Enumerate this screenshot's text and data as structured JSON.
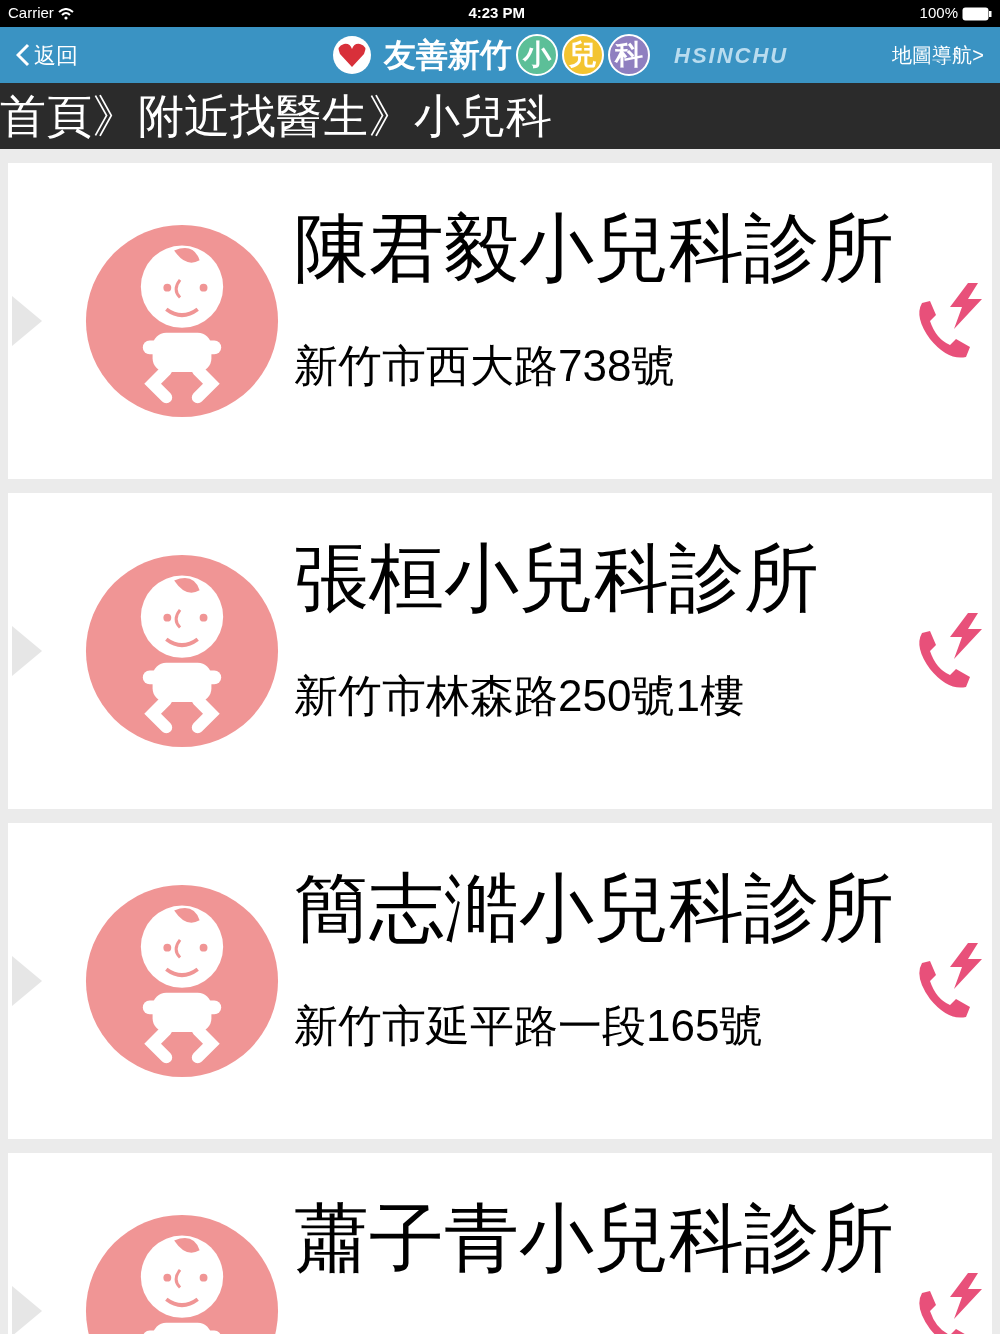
{
  "status_bar": {
    "carrier": "Carrier",
    "time": "4:23 PM",
    "battery": "100%"
  },
  "nav_bar": {
    "back": "返回",
    "title": "友善新竹",
    "title_badges": [
      {
        "text": "小",
        "color": "#5cbf98"
      },
      {
        "text": "兒",
        "color": "#f3c431"
      },
      {
        "text": "科",
        "color": "#8f7fc0"
      }
    ],
    "logo_text": "HSINCHU",
    "map_link": "地圖導航>"
  },
  "breadcrumb": "首頁》附近找醫生》小兒科",
  "clinics": [
    {
      "name": "陳君毅小兒科診所",
      "address": "新竹市西大路738號"
    },
    {
      "name": "張桓小兒科診所",
      "address": "新竹市林森路250號1樓"
    },
    {
      "name": "簡志澔小兒科診所",
      "address": "新竹市延平路一段165號"
    },
    {
      "name": "蕭子青小兒科診所"
    }
  ]
}
